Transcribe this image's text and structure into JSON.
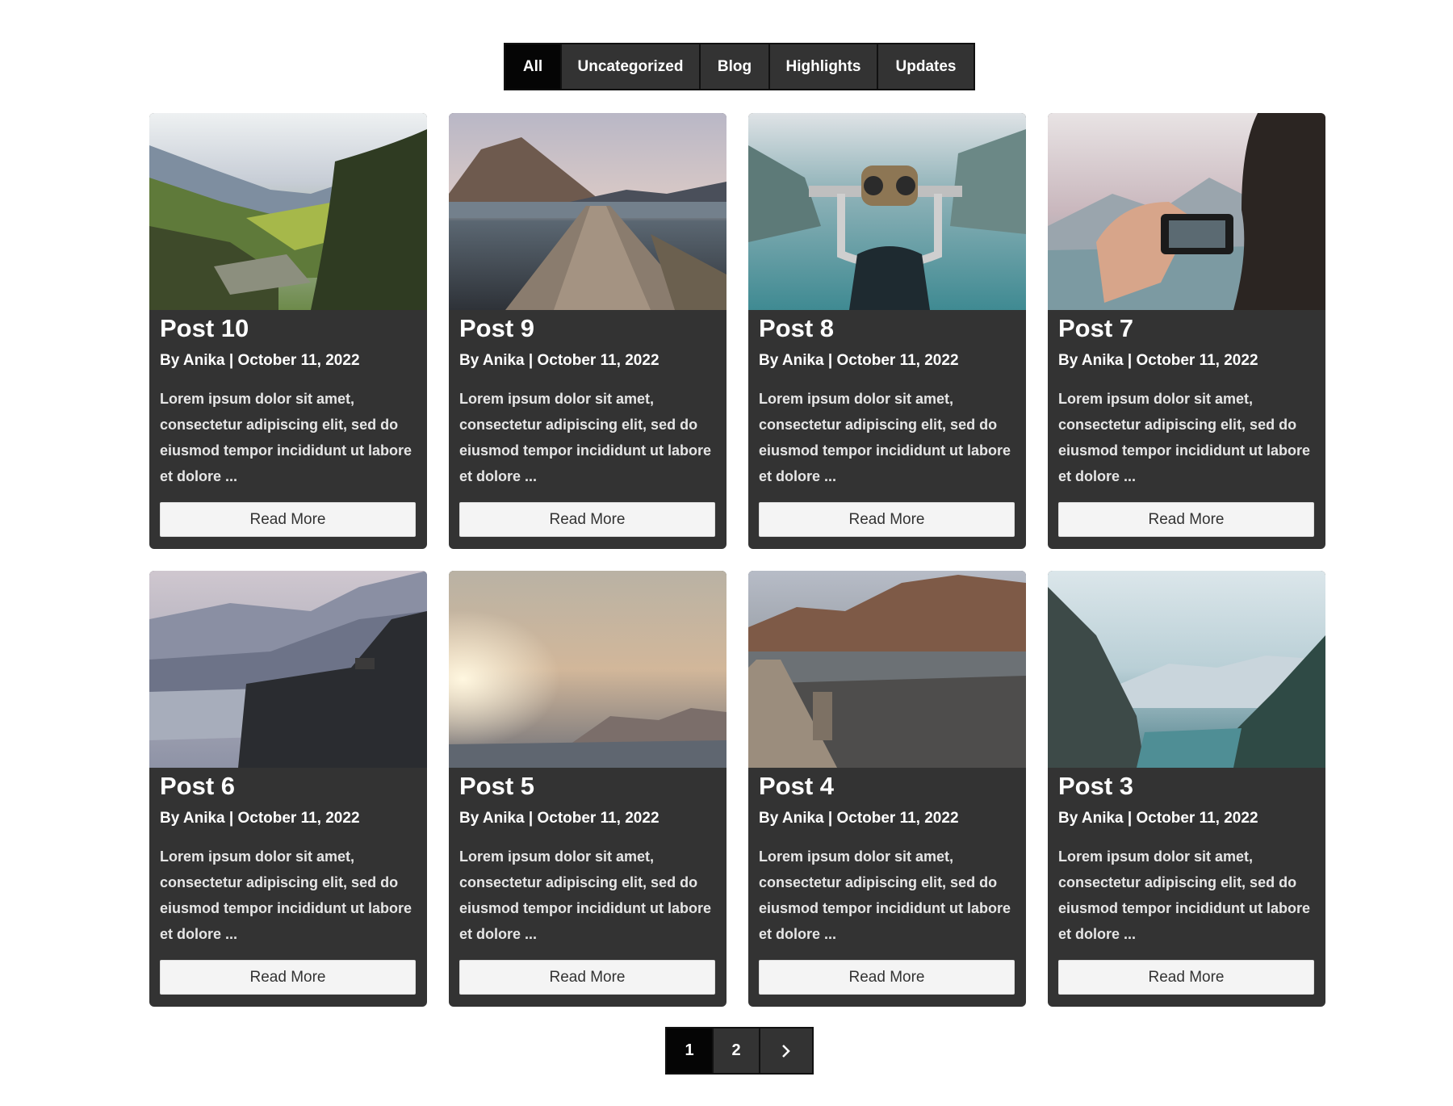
{
  "filters": [
    {
      "label": "All",
      "active": true
    },
    {
      "label": "Uncategorized",
      "active": false
    },
    {
      "label": "Blog",
      "active": false
    },
    {
      "label": "Highlights",
      "active": false
    },
    {
      "label": "Updates",
      "active": false
    }
  ],
  "posts": [
    {
      "title": "Post 10",
      "meta": "By Anika | October 11, 2022",
      "excerpt": "Lorem ipsum dolor sit amet, consectetur adipiscing elit, sed do eiusmod tempor incididunt ut labore et dolore ...",
      "read_more": "Read More"
    },
    {
      "title": "Post 9",
      "meta": "By Anika | October 11, 2022",
      "excerpt": "Lorem ipsum dolor sit amet, consectetur adipiscing elit, sed do eiusmod tempor incididunt ut labore et dolore ...",
      "read_more": "Read More"
    },
    {
      "title": "Post 8",
      "meta": "By Anika | October 11, 2022",
      "excerpt": "Lorem ipsum dolor sit amet, consectetur adipiscing elit, sed do eiusmod tempor incididunt ut labore et dolore ...",
      "read_more": "Read More"
    },
    {
      "title": "Post 7",
      "meta": "By Anika | October 11, 2022",
      "excerpt": "Lorem ipsum dolor sit amet, consectetur adipiscing elit, sed do eiusmod tempor incididunt ut labore et dolore ...",
      "read_more": "Read More"
    },
    {
      "title": "Post 6",
      "meta": "By Anika | October 11, 2022",
      "excerpt": "Lorem ipsum dolor sit amet, consectetur adipiscing elit, sed do eiusmod tempor incididunt ut labore et dolore ...",
      "read_more": "Read More"
    },
    {
      "title": "Post 5",
      "meta": "By Anika | October 11, 2022",
      "excerpt": "Lorem ipsum dolor sit amet, consectetur adipiscing elit, sed do eiusmod tempor incididunt ut labore et dolore ...",
      "read_more": "Read More"
    },
    {
      "title": "Post 4",
      "meta": "By Anika | October 11, 2022",
      "excerpt": "Lorem ipsum dolor sit amet, consectetur adipiscing elit, sed do eiusmod tempor incididunt ut labore et dolore ...",
      "read_more": "Read More"
    },
    {
      "title": "Post 3",
      "meta": "By Anika | October 11, 2022",
      "excerpt": "Lorem ipsum dolor sit amet, consectetur adipiscing elit, sed do eiusmod tempor incididunt ut labore et dolore ...",
      "read_more": "Read More"
    }
  ],
  "pagination": {
    "page1": "1",
    "page2": "2",
    "next_icon": "chevron-right-icon"
  }
}
